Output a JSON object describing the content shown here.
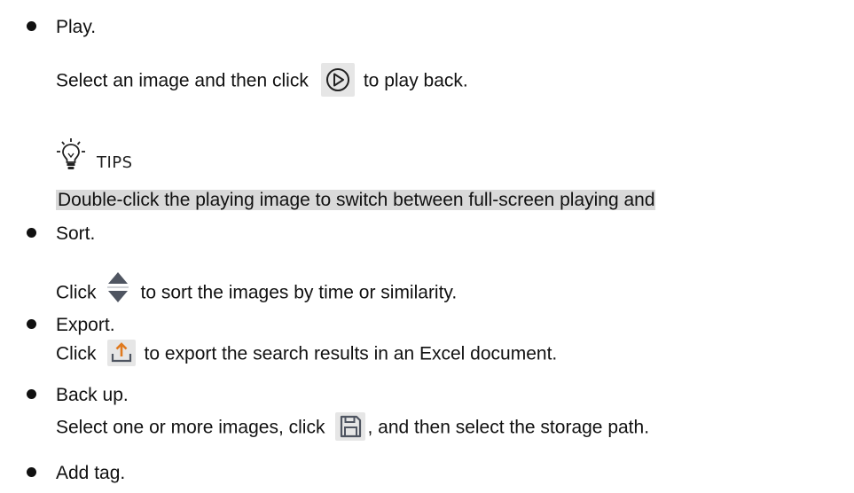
{
  "items": {
    "play": {
      "title": "Play.",
      "desc_before": "Select an image and then click",
      "desc_after": "to play back.",
      "icon": "play-circle-icon"
    },
    "tips": {
      "label": "TIPS",
      "text": "Double-click the playing image to switch between full-screen playing and",
      "icon": "lightbulb-icon"
    },
    "sort": {
      "title": "Sort.",
      "desc_before": "Click",
      "desc_after": "to sort the images by time or similarity.",
      "icon": "sort-arrows-icon"
    },
    "export": {
      "title": "Export.",
      "desc_before": "Click",
      "desc_after": "to export the search results in an Excel document.",
      "icon": "export-upload-icon"
    },
    "backup": {
      "title": "Back up.",
      "desc_before": "Select one or more images, click",
      "desc_after": ", and then select the storage path.",
      "icon": "save-disk-icon"
    },
    "addtag": {
      "title": "Add tag."
    }
  },
  "colors": {
    "text": "#111111",
    "icon_bg": "#e6e6e6",
    "highlight_bg": "#d9d9d9",
    "sort_icon": "#4f5561"
  }
}
